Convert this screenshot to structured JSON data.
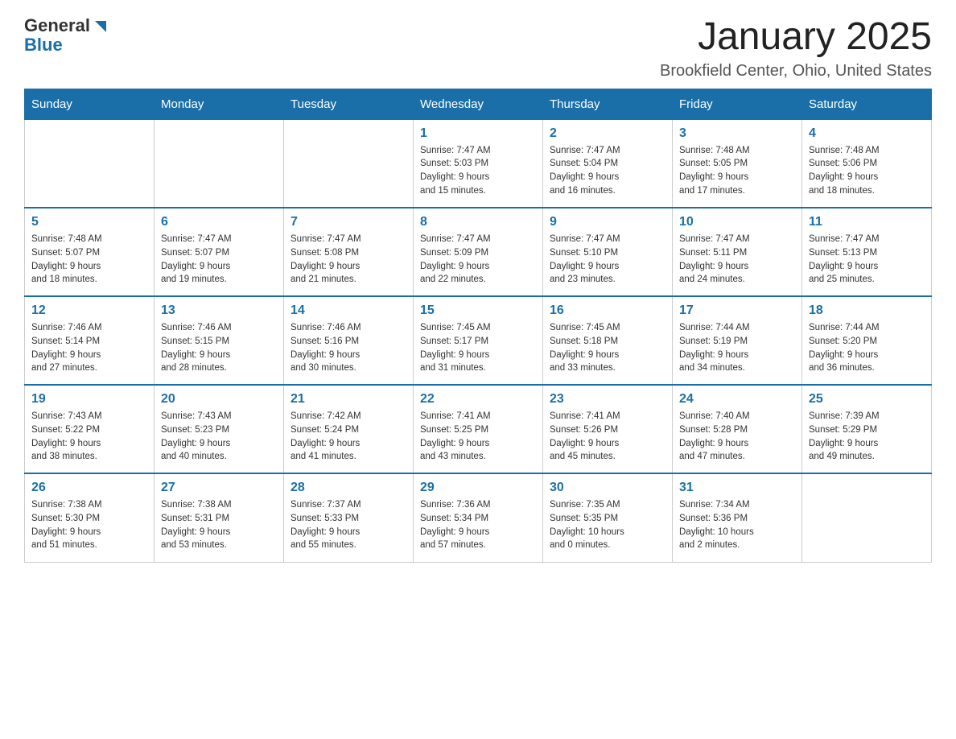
{
  "header": {
    "logo_general": "General",
    "logo_blue": "Blue",
    "month_title": "January 2025",
    "location": "Brookfield Center, Ohio, United States"
  },
  "days_of_week": [
    "Sunday",
    "Monday",
    "Tuesday",
    "Wednesday",
    "Thursday",
    "Friday",
    "Saturday"
  ],
  "weeks": [
    [
      {
        "day": "",
        "info": ""
      },
      {
        "day": "",
        "info": ""
      },
      {
        "day": "",
        "info": ""
      },
      {
        "day": "1",
        "info": "Sunrise: 7:47 AM\nSunset: 5:03 PM\nDaylight: 9 hours\nand 15 minutes."
      },
      {
        "day": "2",
        "info": "Sunrise: 7:47 AM\nSunset: 5:04 PM\nDaylight: 9 hours\nand 16 minutes."
      },
      {
        "day": "3",
        "info": "Sunrise: 7:48 AM\nSunset: 5:05 PM\nDaylight: 9 hours\nand 17 minutes."
      },
      {
        "day": "4",
        "info": "Sunrise: 7:48 AM\nSunset: 5:06 PM\nDaylight: 9 hours\nand 18 minutes."
      }
    ],
    [
      {
        "day": "5",
        "info": "Sunrise: 7:48 AM\nSunset: 5:07 PM\nDaylight: 9 hours\nand 18 minutes."
      },
      {
        "day": "6",
        "info": "Sunrise: 7:47 AM\nSunset: 5:07 PM\nDaylight: 9 hours\nand 19 minutes."
      },
      {
        "day": "7",
        "info": "Sunrise: 7:47 AM\nSunset: 5:08 PM\nDaylight: 9 hours\nand 21 minutes."
      },
      {
        "day": "8",
        "info": "Sunrise: 7:47 AM\nSunset: 5:09 PM\nDaylight: 9 hours\nand 22 minutes."
      },
      {
        "day": "9",
        "info": "Sunrise: 7:47 AM\nSunset: 5:10 PM\nDaylight: 9 hours\nand 23 minutes."
      },
      {
        "day": "10",
        "info": "Sunrise: 7:47 AM\nSunset: 5:11 PM\nDaylight: 9 hours\nand 24 minutes."
      },
      {
        "day": "11",
        "info": "Sunrise: 7:47 AM\nSunset: 5:13 PM\nDaylight: 9 hours\nand 25 minutes."
      }
    ],
    [
      {
        "day": "12",
        "info": "Sunrise: 7:46 AM\nSunset: 5:14 PM\nDaylight: 9 hours\nand 27 minutes."
      },
      {
        "day": "13",
        "info": "Sunrise: 7:46 AM\nSunset: 5:15 PM\nDaylight: 9 hours\nand 28 minutes."
      },
      {
        "day": "14",
        "info": "Sunrise: 7:46 AM\nSunset: 5:16 PM\nDaylight: 9 hours\nand 30 minutes."
      },
      {
        "day": "15",
        "info": "Sunrise: 7:45 AM\nSunset: 5:17 PM\nDaylight: 9 hours\nand 31 minutes."
      },
      {
        "day": "16",
        "info": "Sunrise: 7:45 AM\nSunset: 5:18 PM\nDaylight: 9 hours\nand 33 minutes."
      },
      {
        "day": "17",
        "info": "Sunrise: 7:44 AM\nSunset: 5:19 PM\nDaylight: 9 hours\nand 34 minutes."
      },
      {
        "day": "18",
        "info": "Sunrise: 7:44 AM\nSunset: 5:20 PM\nDaylight: 9 hours\nand 36 minutes."
      }
    ],
    [
      {
        "day": "19",
        "info": "Sunrise: 7:43 AM\nSunset: 5:22 PM\nDaylight: 9 hours\nand 38 minutes."
      },
      {
        "day": "20",
        "info": "Sunrise: 7:43 AM\nSunset: 5:23 PM\nDaylight: 9 hours\nand 40 minutes."
      },
      {
        "day": "21",
        "info": "Sunrise: 7:42 AM\nSunset: 5:24 PM\nDaylight: 9 hours\nand 41 minutes."
      },
      {
        "day": "22",
        "info": "Sunrise: 7:41 AM\nSunset: 5:25 PM\nDaylight: 9 hours\nand 43 minutes."
      },
      {
        "day": "23",
        "info": "Sunrise: 7:41 AM\nSunset: 5:26 PM\nDaylight: 9 hours\nand 45 minutes."
      },
      {
        "day": "24",
        "info": "Sunrise: 7:40 AM\nSunset: 5:28 PM\nDaylight: 9 hours\nand 47 minutes."
      },
      {
        "day": "25",
        "info": "Sunrise: 7:39 AM\nSunset: 5:29 PM\nDaylight: 9 hours\nand 49 minutes."
      }
    ],
    [
      {
        "day": "26",
        "info": "Sunrise: 7:38 AM\nSunset: 5:30 PM\nDaylight: 9 hours\nand 51 minutes."
      },
      {
        "day": "27",
        "info": "Sunrise: 7:38 AM\nSunset: 5:31 PM\nDaylight: 9 hours\nand 53 minutes."
      },
      {
        "day": "28",
        "info": "Sunrise: 7:37 AM\nSunset: 5:33 PM\nDaylight: 9 hours\nand 55 minutes."
      },
      {
        "day": "29",
        "info": "Sunrise: 7:36 AM\nSunset: 5:34 PM\nDaylight: 9 hours\nand 57 minutes."
      },
      {
        "day": "30",
        "info": "Sunrise: 7:35 AM\nSunset: 5:35 PM\nDaylight: 10 hours\nand 0 minutes."
      },
      {
        "day": "31",
        "info": "Sunrise: 7:34 AM\nSunset: 5:36 PM\nDaylight: 10 hours\nand 2 minutes."
      },
      {
        "day": "",
        "info": ""
      }
    ]
  ]
}
